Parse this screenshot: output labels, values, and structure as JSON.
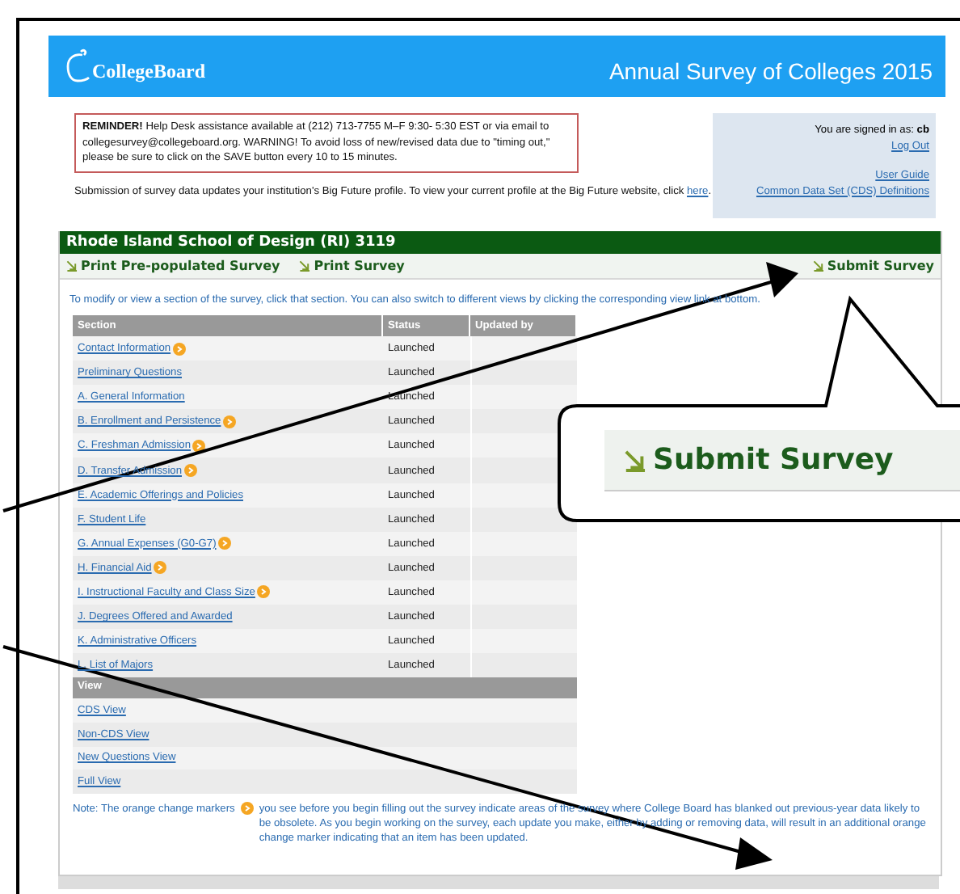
{
  "header": {
    "logo": "CollegeBoard",
    "title": "Annual Survey of Colleges 2015"
  },
  "reminder": {
    "lead": "REMINDER!",
    "text": " Help Desk assistance available at (212) 713-7755 M–F 9:30- 5:30 EST or via email to collegesurvey@collegeboard.org. WARNING! To avoid loss of new/revised data due to \"timing out,\" please be sure to click on the SAVE button every 10 to 15 minutes."
  },
  "submission": {
    "text": "Submission of survey data updates your institution's Big Future profile. To view your current profile at the Big Future website, click ",
    "link": "here",
    "end": "."
  },
  "account": {
    "signed_in": "You are signed in as: **cb**",
    "logout": "Log Out",
    "links": [
      "User Guide",
      "Common Data Set (CDS) Definitions"
    ]
  },
  "institution": "Rhode Island School of Design (RI) 3119",
  "actions": [
    {
      "label": "Print Pre-populated Survey"
    },
    {
      "label": "Print Survey"
    },
    {
      "label": "Submit Survey"
    }
  ],
  "instructions": "To modify or view a section of the survey, click that section. You can also switch to different views by clicking the corresponding view link at bottom.",
  "table": {
    "columns": [
      "Section",
      "Status",
      "Updated by"
    ],
    "rows": [
      {
        "section": "Contact Information",
        "marker": true,
        "status": "Launched"
      },
      {
        "section": "Preliminary Questions",
        "marker": false,
        "status": "Launched"
      },
      {
        "section": "A. General Information",
        "marker": false,
        "status": "Launched"
      },
      {
        "section": "B. Enrollment and Persistence",
        "marker": true,
        "status": "Launched"
      },
      {
        "section": "C. Freshman Admission",
        "marker": true,
        "status": "Launched"
      },
      {
        "section": "D. Transfer Admission",
        "marker": true,
        "status": "Launched"
      },
      {
        "section": "E. Academic Offerings and Policies",
        "marker": false,
        "status": "Launched"
      },
      {
        "section": "F. Student Life",
        "marker": false,
        "status": "Launched"
      },
      {
        "section": "G. Annual Expenses (G0-G7)",
        "marker": true,
        "status": "Launched"
      },
      {
        "section": "H. Financial Aid",
        "marker": true,
        "status": "Launched"
      },
      {
        "section": "I. Instructional Faculty and Class Size",
        "marker": true,
        "status": "Launched"
      },
      {
        "section": "J. Degrees Offered and Awarded",
        "marker": false,
        "status": "Launched"
      },
      {
        "section": "K. Administrative Officers",
        "marker": false,
        "status": "Launched"
      },
      {
        "section": "L. List of Majors",
        "marker": false,
        "status": "Launched"
      }
    ]
  },
  "views": {
    "heading": "View",
    "items": [
      "CDS View",
      "Non-CDS View",
      "New Questions View",
      "Full View"
    ]
  },
  "note": {
    "before": "Note: The orange change markers",
    "after": "you see before you begin filling out the survey indicate areas of the survey where College Board has blanked out previous-year data likely to be obsolete. As you begin working on the survey, each update you make, either by adding or removing data, will result in an additional orange change marker indicating that an item has been updated."
  },
  "callout": {
    "label": "Submit Survey"
  }
}
